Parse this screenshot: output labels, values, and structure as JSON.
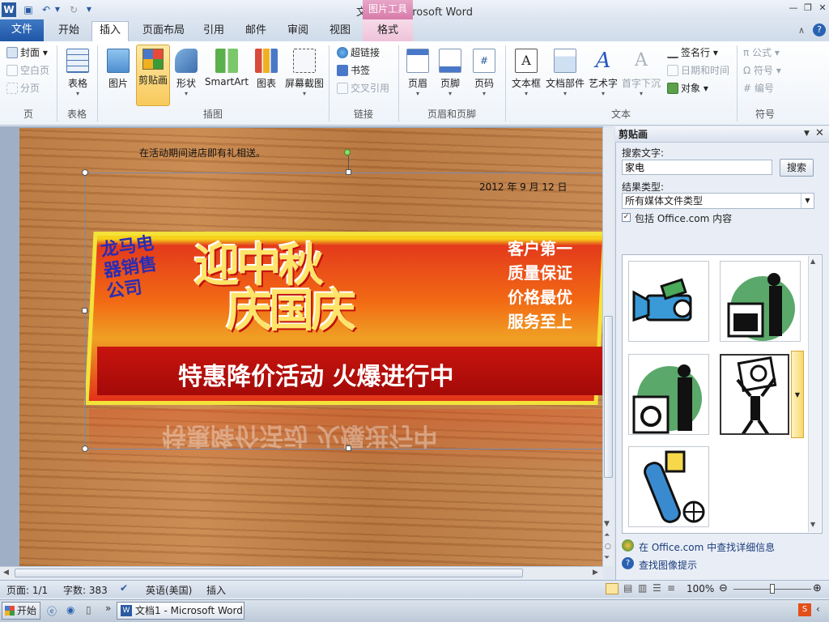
{
  "window": {
    "title": "文档1 - Microsoft Word",
    "context_tab_group": "图片工具"
  },
  "tabs": [
    {
      "label": "文件"
    },
    {
      "label": "开始"
    },
    {
      "label": "插入"
    },
    {
      "label": "页面布局"
    },
    {
      "label": "引用"
    },
    {
      "label": "邮件"
    },
    {
      "label": "审阅"
    },
    {
      "label": "视图"
    },
    {
      "label": "格式"
    }
  ],
  "ribbon": {
    "page": {
      "cover": "封面",
      "blank": "空白页",
      "break": "分页",
      "label": "页"
    },
    "table": {
      "table": "表格",
      "label": "表格"
    },
    "illustrations": {
      "picture": "图片",
      "clipart": "剪贴画",
      "shapes": "形状",
      "smartart": "SmartArt",
      "chart": "图表",
      "screenshot": "屏幕截图",
      "label": "插图"
    },
    "links": {
      "hyperlink": "超链接",
      "bookmark": "书签",
      "crossref": "交叉引用",
      "label": "链接"
    },
    "header_footer": {
      "header": "页眉",
      "footer": "页脚",
      "page_number": "页码",
      "label": "页眉和页脚"
    },
    "text": {
      "textbox": "文本框",
      "quickparts": "文档部件",
      "wordart": "艺术字",
      "dropcap": "首字下沉",
      "signature": "签名行",
      "datetime": "日期和时间",
      "object": "对象",
      "label": "文本"
    },
    "symbols": {
      "equation": "公式",
      "symbol": "符号",
      "number": "编号",
      "label": "符号"
    }
  },
  "document": {
    "line1": "在活动期间进店即有礼相送。",
    "date": "2012 年 9 月 12 日",
    "banner": {
      "title_line1": "迎中秋",
      "title_line2": "庆国庆",
      "left_text": "龙马电器销售公司",
      "right_lines": [
        "客户第一",
        "质量保证",
        "价格最优",
        "服务至上"
      ],
      "subtitle": "特惠降价活动 火爆进行中"
    }
  },
  "task_pane": {
    "title": "剪贴画",
    "search_label": "搜索文字:",
    "search_value": "家电",
    "search_button": "搜索",
    "result_type_label": "结果类型:",
    "result_type_value": "所有媒体文件类型",
    "include_office_label": "包括 Office.com 内容",
    "include_office_checked": true,
    "results": [
      {
        "icon": "camcorder-icon"
      },
      {
        "icon": "stove-worker-icon"
      },
      {
        "icon": "washer-worker-icon"
      },
      {
        "icon": "person-lifting-appliance-icon"
      },
      {
        "icon": "remote-and-globe-icon"
      }
    ],
    "link_more": "在 Office.com 中查找详细信息",
    "link_tips": "查找图像提示"
  },
  "status": {
    "page": "页面: 1/1",
    "words": "字数: 383",
    "language": "英语(美国)",
    "mode": "插入",
    "zoom": "100%"
  },
  "taskbar": {
    "start": "开始",
    "task_item": "文档1 - Microsoft Word"
  },
  "colors": {
    "file_tab": "#2a62b2",
    "context_tab": "#d77aa9",
    "ribbon_bg": "#ffffff"
  }
}
